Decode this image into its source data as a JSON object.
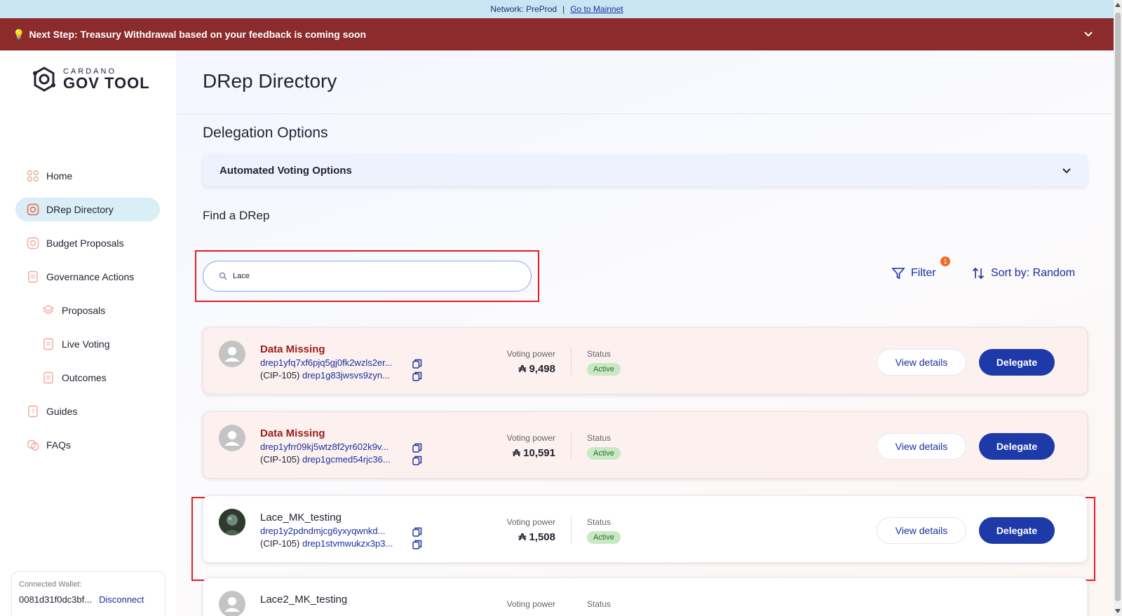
{
  "network_bar": {
    "label": "Network: PreProd",
    "separator": "|",
    "link": "Go to Mainnet"
  },
  "banner": {
    "icon": "lightbulb-icon",
    "text": "Next Step: Treasury Withdrawal based on your feedback is coming soon"
  },
  "logo": {
    "line1": "CARDANO",
    "line2": "GOV TOOL"
  },
  "sidebar": {
    "items": [
      {
        "label": "Home",
        "icon": "home-grid-icon",
        "active": false,
        "sub": false
      },
      {
        "label": "DRep Directory",
        "icon": "drep-icon",
        "active": true,
        "sub": false
      },
      {
        "label": "Budget Proposals",
        "icon": "budget-icon",
        "active": false,
        "sub": false
      },
      {
        "label": "Governance Actions",
        "icon": "document-icon",
        "active": false,
        "sub": false
      },
      {
        "label": "Proposals",
        "icon": "layers-icon",
        "active": false,
        "sub": true
      },
      {
        "label": "Live Voting",
        "icon": "document-icon",
        "active": false,
        "sub": true
      },
      {
        "label": "Outcomes",
        "icon": "document-icon",
        "active": false,
        "sub": true
      },
      {
        "label": "Guides",
        "icon": "guide-icon",
        "active": false,
        "sub": false
      },
      {
        "label": "FAQs",
        "icon": "faq-icon",
        "active": false,
        "sub": false
      }
    ],
    "wallet": {
      "label": "Connected Wallet:",
      "address": "0081d31f0dc3bf...",
      "disconnect": "Disconnect"
    }
  },
  "main": {
    "title": "DRep Directory",
    "delegation_title": "Delegation Options",
    "accordion_label": "Automated Voting Options",
    "find_label": "Find a DRep",
    "search": {
      "value": "Lace",
      "placeholder": ""
    },
    "filter": {
      "label": "Filter",
      "badge": "1"
    },
    "sort": {
      "label": "Sort by: Random"
    },
    "cards": [
      {
        "name": "Data Missing",
        "id": "drep1yfq7xf6pjq5gj0fk2wzls2er...",
        "cip_prefix": "(CIP-105)",
        "cip_id": "drep1g83jwsvs9zyn...",
        "voting_power_label": "Voting power",
        "voting_power": "₳ 9,498",
        "status_label": "Status",
        "status": "Active",
        "view": "View details",
        "delegate": "Delegate"
      },
      {
        "name": "Data Missing",
        "id": "drep1yfrr09kj5wtz8f2yr602k9v...",
        "cip_prefix": "(CIP-105)",
        "cip_id": "drep1gcmed54rjc36...",
        "voting_power_label": "Voting power",
        "voting_power": "₳ 10,591",
        "status_label": "Status",
        "status": "Active",
        "view": "View details",
        "delegate": "Delegate"
      },
      {
        "name": "Lace_MK_testing",
        "id": "drep1y2pdndmjcg6yxyqwnkd...",
        "cip_prefix": "(CIP-105)",
        "cip_id": "drep1stvmwukzx3p3...",
        "voting_power_label": "Voting power",
        "voting_power": "₳ 1,508",
        "status_label": "Status",
        "status": "Active",
        "view": "View details",
        "delegate": "Delegate"
      },
      {
        "name": "Lace2_MK_testing",
        "voting_power_label": "Voting power",
        "status_label": "Status"
      }
    ]
  },
  "colors": {
    "accent": "#1e3aa8",
    "banner": "#8b2b2b",
    "network_bar": "#c9e4f2",
    "status_active_bg": "#c9e9c4",
    "highlight_box": "#e02020",
    "missing_name": "#9b1c1c"
  }
}
